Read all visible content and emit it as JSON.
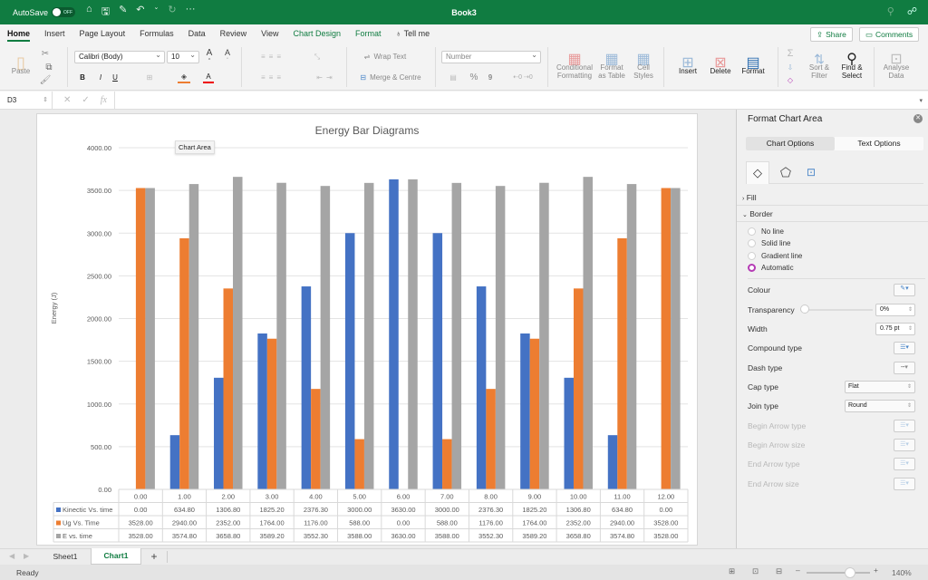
{
  "titlebar": {
    "autosave_label": "AutoSave",
    "autosave_state": "OFF",
    "doc_title": "Book3",
    "more": "···"
  },
  "tabs": [
    {
      "label": "Home",
      "active": true
    },
    {
      "label": "Insert"
    },
    {
      "label": "Page Layout"
    },
    {
      "label": "Formulas"
    },
    {
      "label": "Data"
    },
    {
      "label": "Review"
    },
    {
      "label": "View"
    },
    {
      "label": "Chart Design",
      "contextual": true
    },
    {
      "label": "Format",
      "contextual": true
    },
    {
      "label": "Tell me"
    }
  ],
  "share_label": "Share",
  "comments_label": "Comments",
  "ribbon": {
    "paste": "Paste",
    "font_name": "Calibri (Body)",
    "font_size": "10",
    "wrap_text": "Wrap Text",
    "merge_centre": "Merge & Centre",
    "number_format": "Number",
    "conditional_formatting": [
      "Conditional",
      "Formatting"
    ],
    "format_as_table": [
      "Format",
      "as Table"
    ],
    "cell_styles": [
      "Cell",
      "Styles"
    ],
    "insert": "Insert",
    "delete": "Delete",
    "format": "Format",
    "sort_filter": [
      "Sort &",
      "Filter"
    ],
    "find_select": [
      "Find &",
      "Select"
    ],
    "analyse_data": [
      "Analyse",
      "Data"
    ],
    "bold": "B",
    "italic": "I",
    "underline": "U",
    "percent": "%",
    "comma": "9"
  },
  "formula_bar": {
    "name_box": "D3",
    "fx": "fx",
    "value": ""
  },
  "tooltip": "Chart Area",
  "chart_data": {
    "type": "bar",
    "title": "Energy Bar Diagrams",
    "xlabel": "",
    "ylabel": "Energy (J)",
    "ylim": [
      0,
      4000
    ],
    "yticks": [
      "0.00",
      "500.00",
      "1000.00",
      "1500.00",
      "2000.00",
      "2500.00",
      "3000.00",
      "3500.00",
      "4000.00"
    ],
    "ytick_values": [
      0,
      500,
      1000,
      1500,
      2000,
      2500,
      3000,
      3500,
      4000
    ],
    "grid": true,
    "legend": "data-table",
    "categories": [
      "0.00",
      "1.00",
      "2.00",
      "3.00",
      "4.00",
      "5.00",
      "6.00",
      "7.00",
      "8.00",
      "9.00",
      "10.00",
      "11.00",
      "12.00"
    ],
    "series": [
      {
        "name": "Kinectic Vs. time",
        "color": "#4472c4",
        "values": [
          0.0,
          634.8,
          1306.8,
          1825.2,
          2376.3,
          3000.0,
          3630.0,
          3000.0,
          2376.3,
          1825.2,
          1306.8,
          634.8,
          0.0
        ],
        "labels": [
          "0.00",
          "634.80",
          "1306.80",
          "1825.20",
          "2376.30",
          "3000.00",
          "3630.00",
          "3000.00",
          "2376.30",
          "1825.20",
          "1306.80",
          "634.80",
          "0.00"
        ]
      },
      {
        "name": "Ug Vs. Time",
        "color": "#ed7d31",
        "values": [
          3528.0,
          2940.0,
          2352.0,
          1764.0,
          1176.0,
          588.0,
          0.0,
          588.0,
          1176.0,
          1764.0,
          2352.0,
          2940.0,
          3528.0
        ],
        "labels": [
          "3528.00",
          "2940.00",
          "2352.00",
          "1764.00",
          "1176.00",
          "588.00",
          "0.00",
          "588.00",
          "1176.00",
          "1764.00",
          "2352.00",
          "2940.00",
          "3528.00"
        ]
      },
      {
        "name": "E vs. time",
        "color": "#a5a5a5",
        "values": [
          3528.0,
          3574.8,
          3658.8,
          3589.2,
          3552.3,
          3588.0,
          3630.0,
          3588.0,
          3552.3,
          3589.2,
          3658.8,
          3574.8,
          3528.0
        ],
        "labels": [
          "3528.00",
          "3574.80",
          "3658.80",
          "3589.20",
          "3552.30",
          "3588.00",
          "3630.00",
          "3588.00",
          "3552.30",
          "3589.20",
          "3658.80",
          "3574.80",
          "3528.00"
        ]
      }
    ]
  },
  "pane": {
    "title": "Format Chart Area",
    "tabs": [
      "Chart Options",
      "Text Options"
    ],
    "active_tab": "Chart Options",
    "sections": {
      "fill": "Fill",
      "border": "Border"
    },
    "border_options": [
      {
        "label": "No line",
        "selected": false
      },
      {
        "label": "Solid line",
        "selected": false
      },
      {
        "label": "Gradient line",
        "selected": false
      },
      {
        "label": "Automatic",
        "selected": true
      }
    ],
    "props": {
      "colour": "Colour",
      "transparency": "Transparency",
      "transparency_value": "0%",
      "transparency_level": 0,
      "width": "Width",
      "width_value": "0.75 pt",
      "compound_type": "Compound type",
      "dash_type": "Dash type",
      "cap_type": "Cap type",
      "cap_value": "Flat",
      "join_type": "Join type",
      "join_value": "Round",
      "begin_arrow_type": "Begin Arrow type",
      "begin_arrow_size": "Begin Arrow size",
      "end_arrow_type": "End Arrow type",
      "end_arrow_size": "End Arrow size"
    }
  },
  "sheets": [
    {
      "label": "Sheet1",
      "active": false
    },
    {
      "label": "Chart1",
      "active": true
    }
  ],
  "add_sheet": "+",
  "status": {
    "ready": "Ready",
    "zoom": "140%",
    "zoom_level": 0.72
  }
}
